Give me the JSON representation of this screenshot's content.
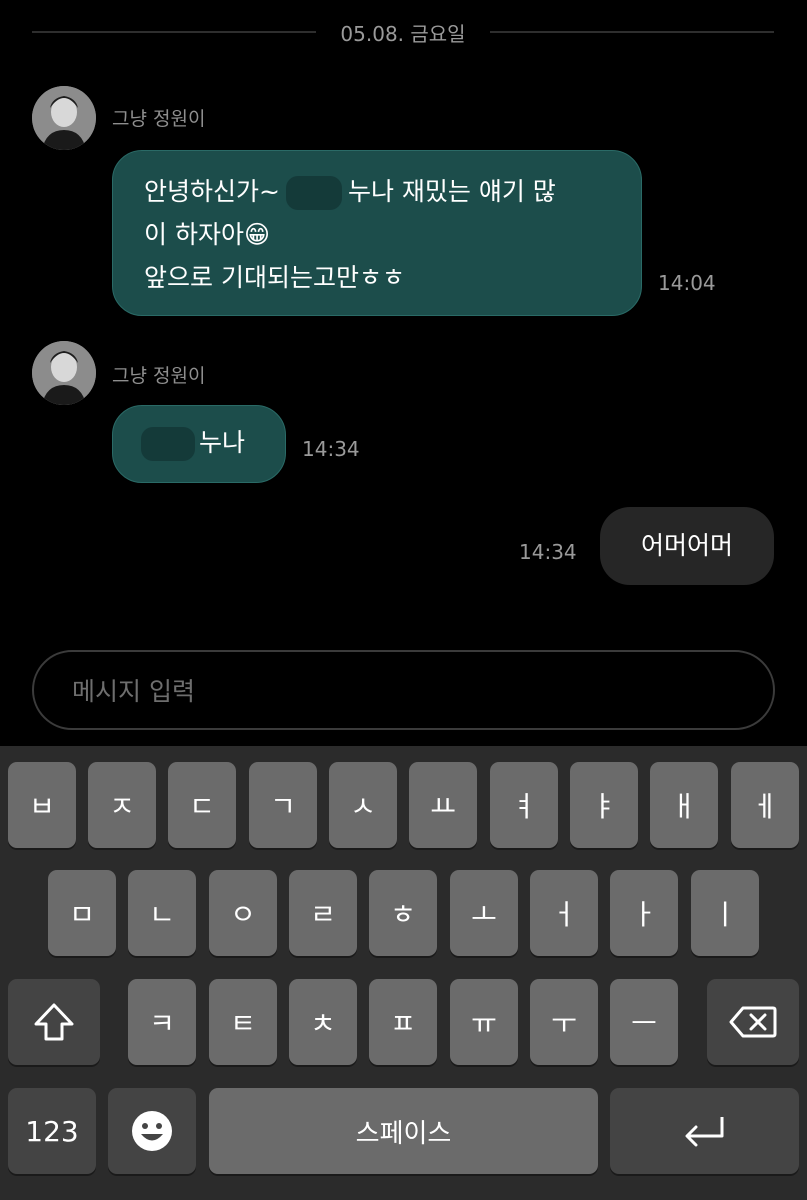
{
  "date_divider": "05.08. 금요일",
  "messages": [
    {
      "sender": "그냥 정원이",
      "lines": [
        "안녕하신가~",
        "누나 재밌는 얘기 많",
        "이 하자아😁",
        "앞으로 기대되는고만ㅎㅎ"
      ],
      "time": "14:04"
    },
    {
      "sender": "그냥 정원이",
      "text": "누나",
      "time": "14:34"
    },
    {
      "text": "어머어머",
      "time": "14:34"
    }
  ],
  "input": {
    "placeholder": "메시지 입력"
  },
  "keyboard": {
    "row1": [
      "ㅂ",
      "ㅈ",
      "ㄷ",
      "ㄱ",
      "ㅅ",
      "ㅛ",
      "ㅕ",
      "ㅑ",
      "ㅐ",
      "ㅔ"
    ],
    "row2": [
      "ㅁ",
      "ㄴ",
      "ㅇ",
      "ㄹ",
      "ㅎ",
      "ㅗ",
      "ㅓ",
      "ㅏ",
      "ㅣ"
    ],
    "row3": [
      "ㅋ",
      "ㅌ",
      "ㅊ",
      "ㅍ",
      "ㅠ",
      "ㅜ",
      "ㅡ"
    ],
    "numbers_label": "123",
    "space_label": "스페이스",
    "icons": [
      "shift-icon",
      "backspace-icon",
      "emoji-icon",
      "return-icon"
    ]
  },
  "colors": {
    "incoming_bubble": "#1c4d4b",
    "outgoing_bubble": "#262626",
    "keyboard_bg": "#2b2b2b",
    "key": "#6b6b6b"
  }
}
